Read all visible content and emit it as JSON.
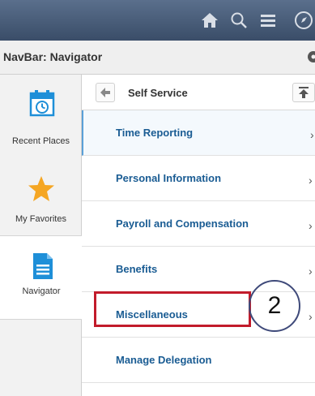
{
  "navbar": {
    "icons": [
      "home-icon",
      "search-icon",
      "menu-icon",
      "compass-icon"
    ],
    "title": "NavBar: Navigator"
  },
  "left_tiles": [
    {
      "label": "Recent Places",
      "icon": "calendar-clock-icon"
    },
    {
      "label": "My Favorites",
      "icon": "star-icon"
    },
    {
      "label": "Navigator",
      "icon": "document-icon"
    }
  ],
  "self_service": {
    "title": "Self Service",
    "items": [
      "Time Reporting",
      "Personal Information",
      "Payroll and Compensation",
      "Benefits",
      "Miscellaneous",
      "Manage Delegation"
    ]
  },
  "annotation": {
    "step": "2",
    "color": "#c21b2b"
  }
}
